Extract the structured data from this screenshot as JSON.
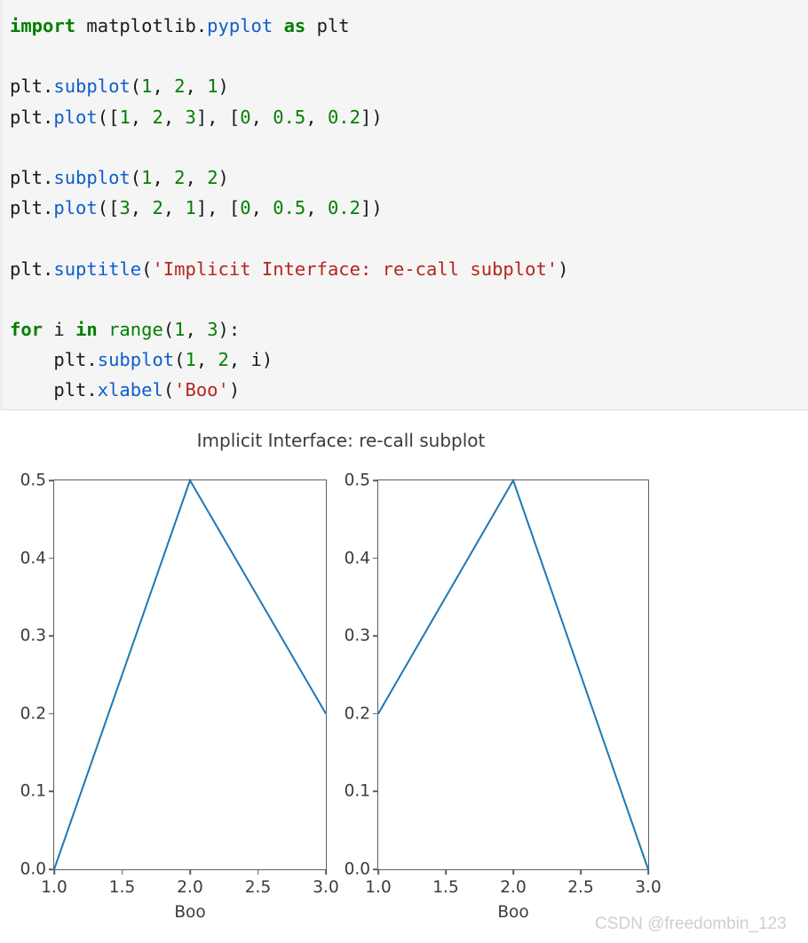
{
  "code_block": {
    "language": "python",
    "lines": [
      [
        {
          "t": "import",
          "c": "kw"
        },
        {
          "t": " matplotlib.",
          "c": "pl"
        },
        {
          "t": "pyplot",
          "c": "fn"
        },
        {
          "t": " ",
          "c": "pl"
        },
        {
          "t": "as",
          "c": "kw"
        },
        {
          "t": " plt",
          "c": "pl"
        }
      ],
      [],
      [
        {
          "t": "plt.",
          "c": "pl"
        },
        {
          "t": "subplot",
          "c": "fn"
        },
        {
          "t": "(",
          "c": "pl"
        },
        {
          "t": "1",
          "c": "num"
        },
        {
          "t": ", ",
          "c": "pl"
        },
        {
          "t": "2",
          "c": "num"
        },
        {
          "t": ", ",
          "c": "pl"
        },
        {
          "t": "1",
          "c": "num"
        },
        {
          "t": ")",
          "c": "pl"
        }
      ],
      [
        {
          "t": "plt.",
          "c": "pl"
        },
        {
          "t": "plot",
          "c": "fn"
        },
        {
          "t": "([",
          "c": "pl"
        },
        {
          "t": "1",
          "c": "num"
        },
        {
          "t": ", ",
          "c": "pl"
        },
        {
          "t": "2",
          "c": "num"
        },
        {
          "t": ", ",
          "c": "pl"
        },
        {
          "t": "3",
          "c": "num"
        },
        {
          "t": "], [",
          "c": "pl"
        },
        {
          "t": "0",
          "c": "num"
        },
        {
          "t": ", ",
          "c": "pl"
        },
        {
          "t": "0.5",
          "c": "num"
        },
        {
          "t": ", ",
          "c": "pl"
        },
        {
          "t": "0.2",
          "c": "num"
        },
        {
          "t": "])",
          "c": "pl"
        }
      ],
      [],
      [
        {
          "t": "plt.",
          "c": "pl"
        },
        {
          "t": "subplot",
          "c": "fn"
        },
        {
          "t": "(",
          "c": "pl"
        },
        {
          "t": "1",
          "c": "num"
        },
        {
          "t": ", ",
          "c": "pl"
        },
        {
          "t": "2",
          "c": "num"
        },
        {
          "t": ", ",
          "c": "pl"
        },
        {
          "t": "2",
          "c": "num"
        },
        {
          "t": ")",
          "c": "pl"
        }
      ],
      [
        {
          "t": "plt.",
          "c": "pl"
        },
        {
          "t": "plot",
          "c": "fn"
        },
        {
          "t": "([",
          "c": "pl"
        },
        {
          "t": "3",
          "c": "num"
        },
        {
          "t": ", ",
          "c": "pl"
        },
        {
          "t": "2",
          "c": "num"
        },
        {
          "t": ", ",
          "c": "pl"
        },
        {
          "t": "1",
          "c": "num"
        },
        {
          "t": "], [",
          "c": "pl"
        },
        {
          "t": "0",
          "c": "num"
        },
        {
          "t": ", ",
          "c": "pl"
        },
        {
          "t": "0.5",
          "c": "num"
        },
        {
          "t": ", ",
          "c": "pl"
        },
        {
          "t": "0.2",
          "c": "num"
        },
        {
          "t": "])",
          "c": "pl"
        }
      ],
      [],
      [
        {
          "t": "plt.",
          "c": "pl"
        },
        {
          "t": "suptitle",
          "c": "fn"
        },
        {
          "t": "(",
          "c": "pl"
        },
        {
          "t": "'Implicit Interface: re-call subplot'",
          "c": "str"
        },
        {
          "t": ")",
          "c": "pl"
        }
      ],
      [],
      [
        {
          "t": "for",
          "c": "kw"
        },
        {
          "t": " i ",
          "c": "pl"
        },
        {
          "t": "in",
          "c": "kw"
        },
        {
          "t": " ",
          "c": "pl"
        },
        {
          "t": "range",
          "c": "bi"
        },
        {
          "t": "(",
          "c": "pl"
        },
        {
          "t": "1",
          "c": "num"
        },
        {
          "t": ", ",
          "c": "pl"
        },
        {
          "t": "3",
          "c": "num"
        },
        {
          "t": "):",
          "c": "pl"
        }
      ],
      [
        {
          "t": "    plt.",
          "c": "pl"
        },
        {
          "t": "subplot",
          "c": "fn"
        },
        {
          "t": "(",
          "c": "pl"
        },
        {
          "t": "1",
          "c": "num"
        },
        {
          "t": ", ",
          "c": "pl"
        },
        {
          "t": "2",
          "c": "num"
        },
        {
          "t": ", i)",
          "c": "pl"
        }
      ],
      [
        {
          "t": "    plt.",
          "c": "pl"
        },
        {
          "t": "xlabel",
          "c": "fn"
        },
        {
          "t": "(",
          "c": "pl"
        },
        {
          "t": "'Boo'",
          "c": "str"
        },
        {
          "t": ")",
          "c": "pl"
        }
      ]
    ],
    "colors": {
      "background": "#f5f5f5",
      "keyword": "#007f00",
      "function": "#0d5ecb",
      "number": "#007f00",
      "string": "#b3261e",
      "plain": "#1a1a1a"
    }
  },
  "figure": {
    "suptitle": "Implicit Interface: re-call subplot",
    "watermark": "CSDN @freedombin_123",
    "line_color": "#1f77b4",
    "axis_color": "#5e5e5e",
    "text_color": "#3b3b3b"
  },
  "chart_data": [
    {
      "type": "line",
      "title": "Implicit Interface: re-call subplot",
      "subplot_index": 1,
      "subplot_grid": "1 x 2",
      "x": [
        1,
        2,
        3
      ],
      "y": [
        0,
        0.5,
        0.2
      ],
      "series": [
        {
          "name": "plot([1, 2, 3], [0, 0.5, 0.2])",
          "values": [
            0,
            0.5,
            0.2
          ]
        }
      ],
      "xlabel": "Boo",
      "ylabel": "",
      "xlim": [
        1.0,
        3.0
      ],
      "ylim": [
        0.0,
        0.5
      ],
      "xticks": [
        1.0,
        1.5,
        2.0,
        2.5,
        3.0
      ],
      "xticklabels": [
        "1.0",
        "1.5",
        "2.0",
        "2.5",
        "3.0"
      ],
      "yticks": [
        0.0,
        0.1,
        0.2,
        0.3,
        0.4,
        0.5
      ],
      "yticklabels": [
        "0.0",
        "0.1",
        "0.2",
        "0.3",
        "0.4",
        "0.5"
      ],
      "grid": false,
      "legend": "none",
      "line_color": "#1f77b4"
    },
    {
      "type": "line",
      "title": "Implicit Interface: re-call subplot",
      "subplot_index": 2,
      "subplot_grid": "1 x 2",
      "x": [
        3,
        2,
        1
      ],
      "y": [
        0,
        0.5,
        0.2
      ],
      "series": [
        {
          "name": "plot([3, 2, 1], [0, 0.5, 0.2])",
          "values": [
            0.2,
            0.5,
            0
          ]
        }
      ],
      "xlabel": "Boo",
      "ylabel": "",
      "xlim": [
        1.0,
        3.0
      ],
      "ylim": [
        0.0,
        0.5
      ],
      "xticks": [
        1.0,
        1.5,
        2.0,
        2.5,
        3.0
      ],
      "xticklabels": [
        "1.0",
        "1.5",
        "2.0",
        "2.5",
        "3.0"
      ],
      "yticks": [
        0.0,
        0.1,
        0.2,
        0.3,
        0.4,
        0.5
      ],
      "yticklabels": [
        "0.0",
        "0.1",
        "0.2",
        "0.3",
        "0.4",
        "0.5"
      ],
      "grid": false,
      "legend": "none",
      "line_color": "#1f77b4"
    }
  ]
}
